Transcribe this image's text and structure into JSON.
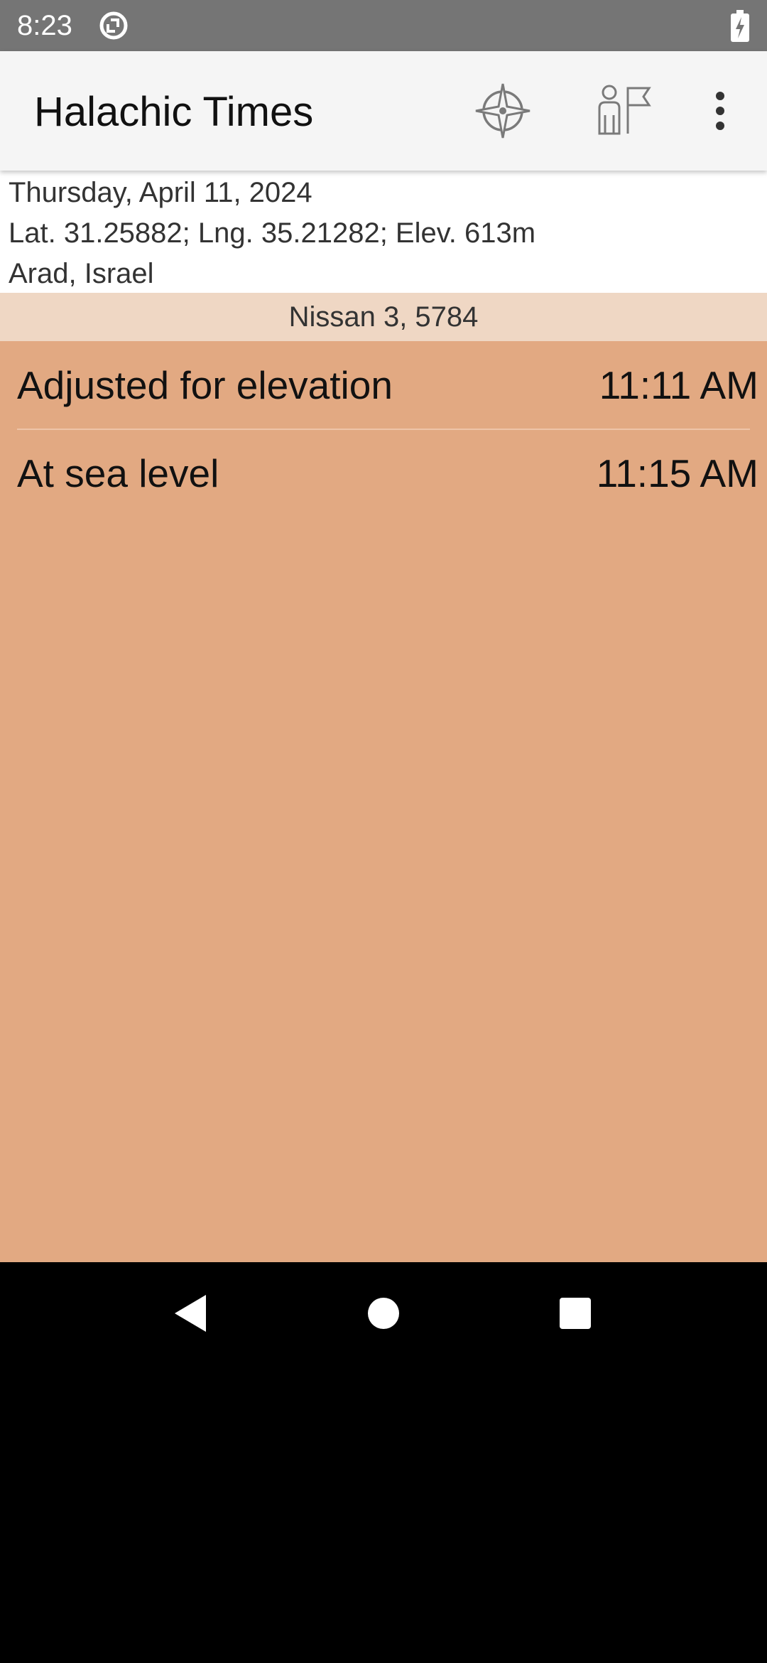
{
  "status_bar": {
    "time": "8:23",
    "icons": [
      "sync-icon",
      "battery-charging-icon"
    ]
  },
  "app_bar": {
    "title": "Halachic Times",
    "actions": [
      {
        "name": "location",
        "icon": "location-crosshair-icon"
      },
      {
        "name": "zmanim",
        "icon": "person-flag-icon"
      },
      {
        "name": "more",
        "icon": "more-vert-icon"
      }
    ]
  },
  "info": {
    "date": "Thursday, April 11, 2024",
    "coordinates": "Lat. 31.25882; Lng. 35.21282; Elev. 613m",
    "place": "Arad, Israel"
  },
  "hebrew_date": "Nissan 3, 5784",
  "times": [
    {
      "label": "Adjusted for elevation",
      "time": "11:11 AM"
    },
    {
      "label": "At sea level",
      "time": "11:15 AM"
    }
  ],
  "colors": {
    "status_bar": "#757575",
    "app_bar": "#f5f5f5",
    "hebrew_date_bar": "#efd7c4",
    "content_background": "#e2a982",
    "nav_bar": "#000000"
  },
  "nav_bar": {
    "buttons": [
      "back-icon",
      "home-icon",
      "recents-icon"
    ]
  }
}
